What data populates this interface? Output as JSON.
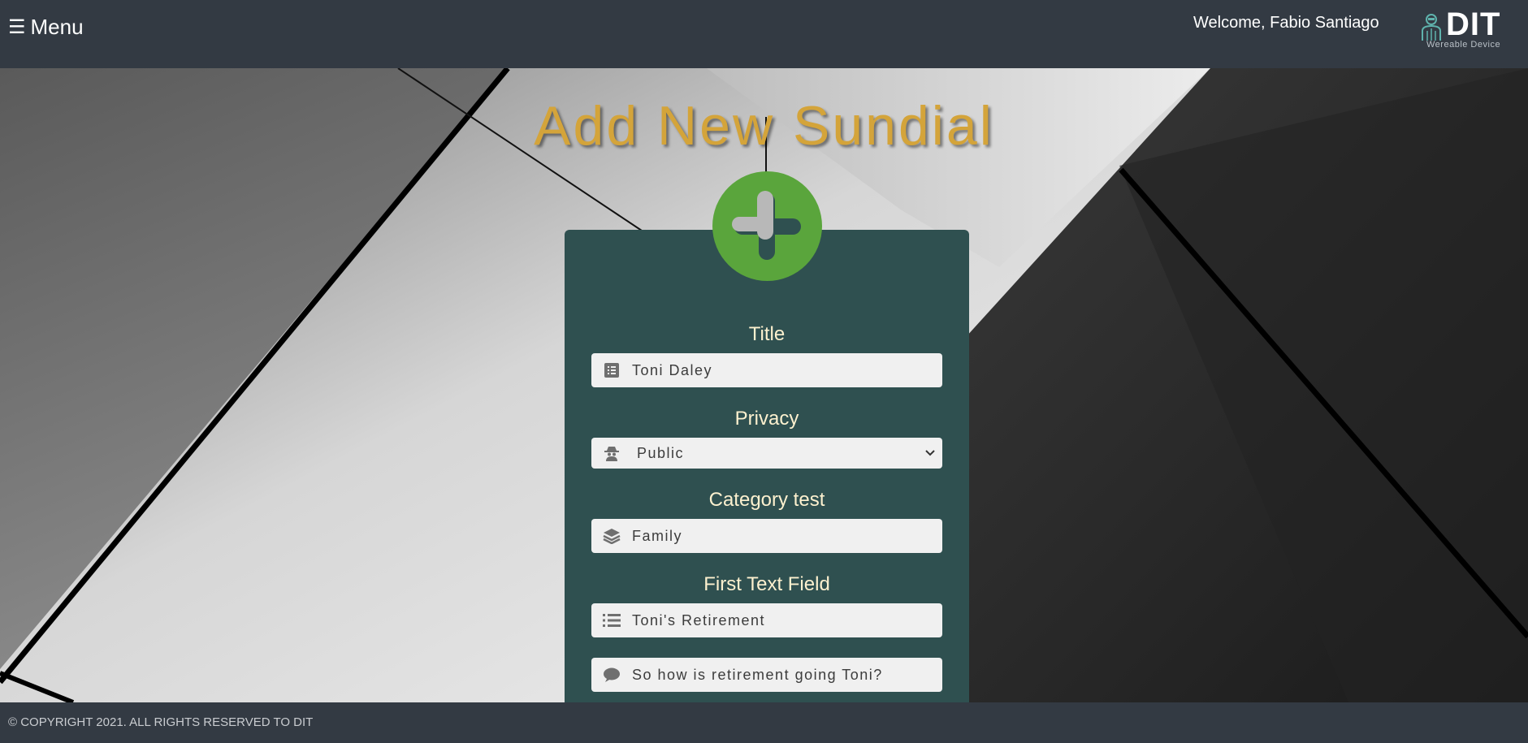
{
  "header": {
    "menu_icon": "hamburger-icon",
    "menu_label": "Menu",
    "welcome": "Welcome, Fabio Santiago",
    "logo": {
      "text": "DIT",
      "subtitle": "Wereable Device"
    }
  },
  "page": {
    "title": "Add New Sundial",
    "badge_icon": "plus-icon"
  },
  "form": {
    "title_label": "Title",
    "title_value": "Toni Daley",
    "title_icon": "list-box-icon",
    "privacy_label": "Privacy",
    "privacy_value": "Public",
    "privacy_icon": "spy-icon",
    "category_label": "Category test",
    "category_value": "Family",
    "category_icon": "layers-icon",
    "first_text_label": "First Text Field",
    "first_text_value": "Toni's Retirement",
    "first_text_icon": "list-icon",
    "comment_value": "So how is  retirement going Toni?",
    "comment_icon": "comment-icon"
  },
  "footer": {
    "copyright": "© COPYRIGHT 2021. ALL RIGHTS RESERVED TO DIT"
  },
  "colors": {
    "topbar": "#333a43",
    "title": "#d4a43a",
    "card": "#2f5050",
    "badge": "#5aa53c",
    "label": "#fdf1cf",
    "field_bg": "#f0f0f0"
  }
}
